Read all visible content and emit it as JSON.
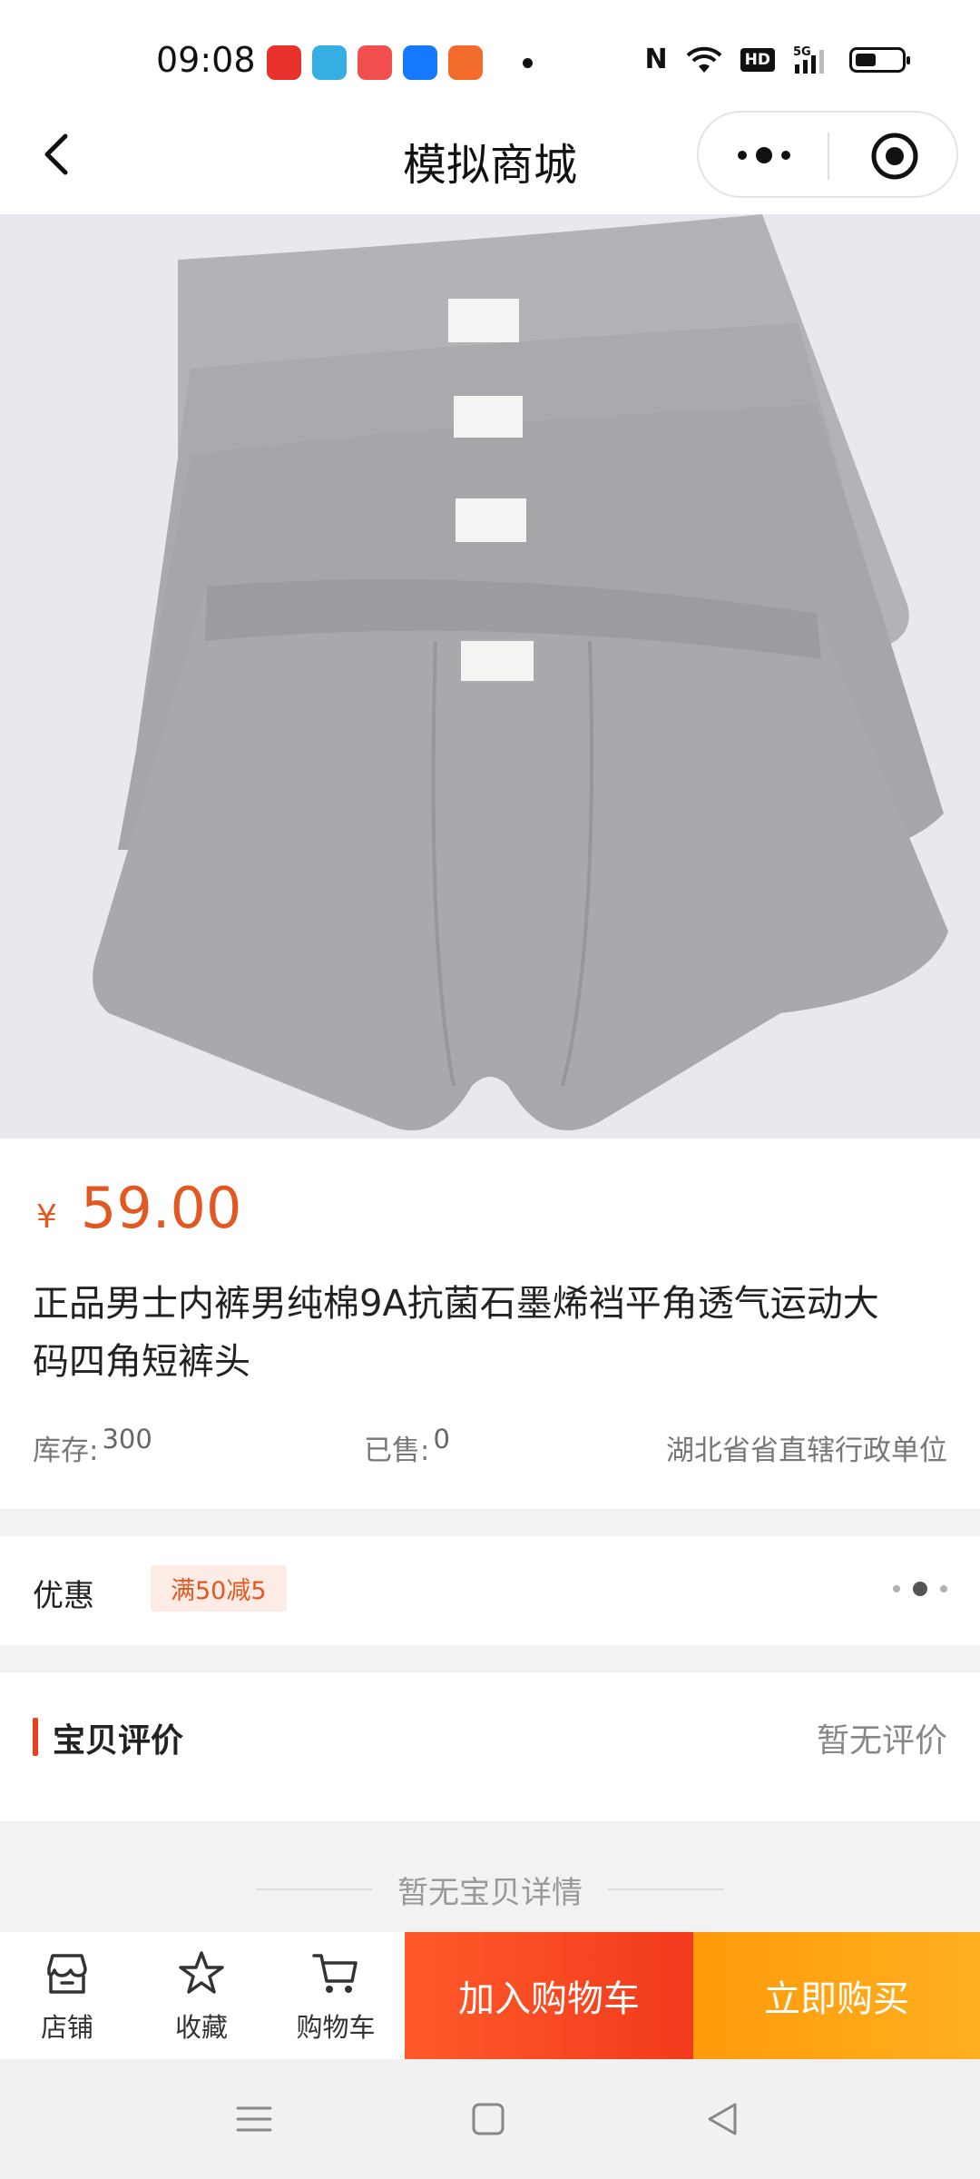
{
  "status_bar": {
    "time": "09:08",
    "icons": [
      "pinduoduo-icon",
      "telegram-icon",
      "jd-icon",
      "alipay-icon",
      "reader-icon"
    ],
    "signal": "5G",
    "hd_label": "HD",
    "nfc_label": "N",
    "battery_level": 0.45
  },
  "nav": {
    "title": "模拟商城",
    "back_icon": "chevron-left-icon",
    "more_icon": "more-dots-icon",
    "target_icon": "target-icon"
  },
  "product": {
    "image_desc_icon": "product-photo",
    "currency": "¥",
    "price": "59.00",
    "title": "正品男士内裤男纯棉9A抗菌石墨烯裆平角透气运动大码四角短裤头",
    "stock_label": "库存:",
    "stock_value": "300",
    "sold_label": "已售:",
    "sold_value": "0",
    "location": "湖北省省直辖行政单位"
  },
  "promo": {
    "label": "优惠",
    "tag": "满50减5"
  },
  "review": {
    "title": "宝贝评价",
    "empty": "暂无评价"
  },
  "details": {
    "empty": "暂无宝贝详情"
  },
  "actions": {
    "shop_label": "店铺",
    "favorite_label": "收藏",
    "cart_label": "购物车",
    "add_to_cart": "加入购物车",
    "buy_now": "立即购买"
  },
  "colors": {
    "accent": "#e25822",
    "cart_button": "#f23a1c",
    "buy_button": "#ffa012"
  }
}
